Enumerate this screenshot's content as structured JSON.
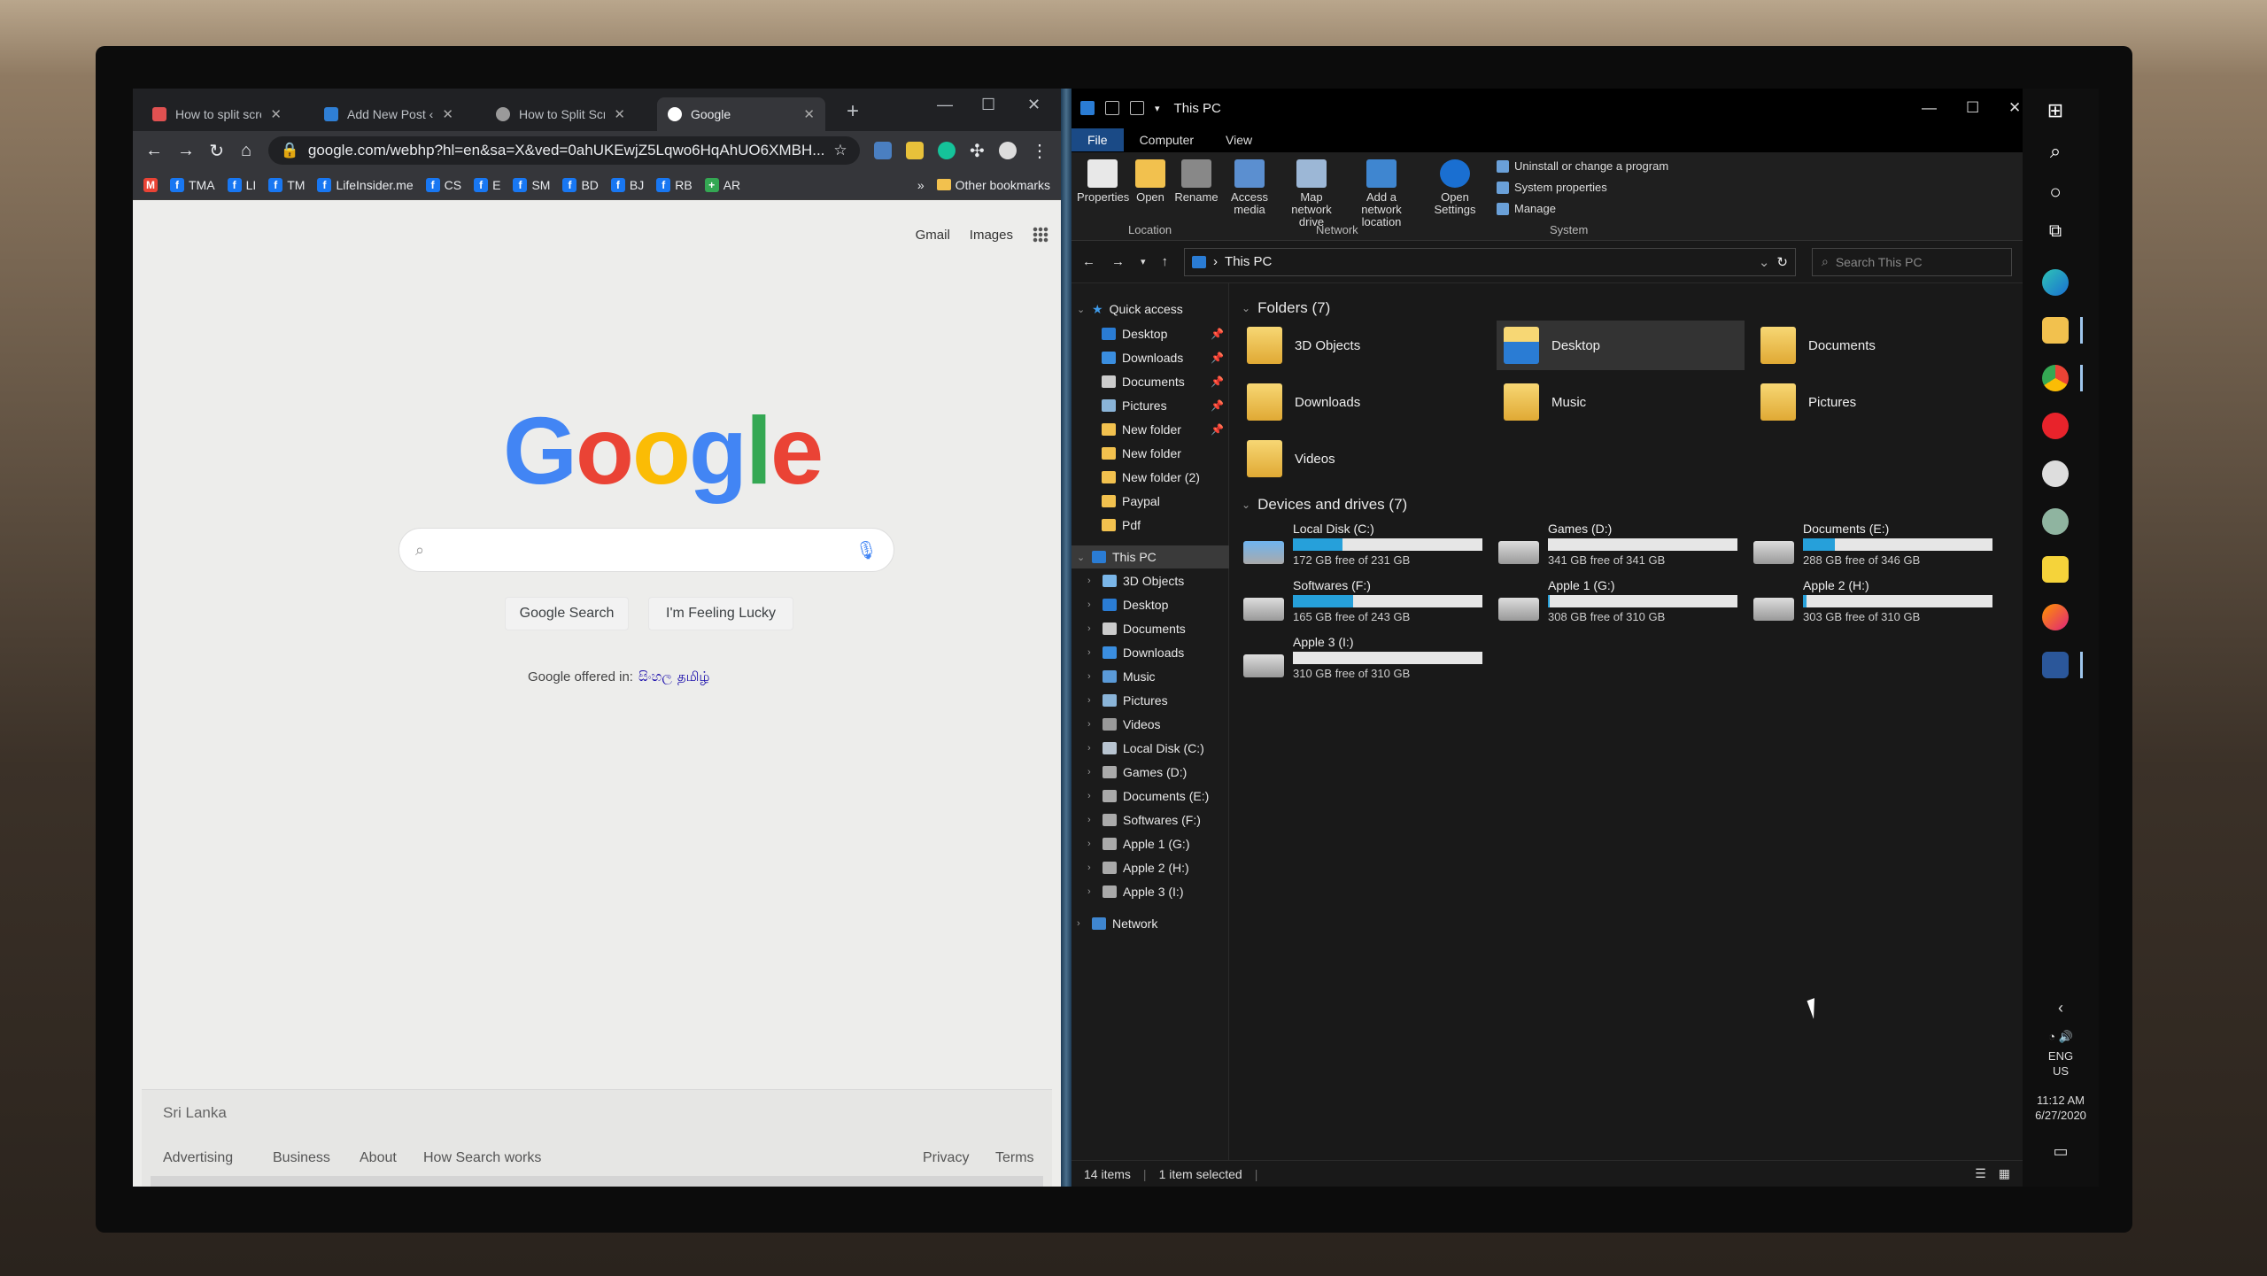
{
  "chrome": {
    "tabs": [
      {
        "label": "How to split screen",
        "color": "#e05151"
      },
      {
        "label": "Add New Post ‹ iHu",
        "color": "#2f7fd5"
      },
      {
        "label": "How to Split Screen",
        "color": "#9a9a9a"
      },
      {
        "label": "Google",
        "color": "#ffffff"
      }
    ],
    "url": "google.com/webhp?hl=en&sa=X&ved=0ahUKEwjZ5Lqwo6HqAhUO6XMBH...",
    "bookmarks": [
      {
        "label": "TMA"
      },
      {
        "label": "LI"
      },
      {
        "label": "TM"
      },
      {
        "label": "LifeInsider.me"
      },
      {
        "label": "CS"
      },
      {
        "label": "E"
      },
      {
        "label": "SM"
      },
      {
        "label": "BD"
      },
      {
        "label": "BJ"
      },
      {
        "label": "RB"
      },
      {
        "label": "AR"
      }
    ],
    "more_bookmarks": "»",
    "other_bookmarks": "Other bookmarks",
    "top_links": {
      "gmail": "Gmail",
      "images": "Images"
    },
    "logo": [
      "G",
      "o",
      "o",
      "g",
      "l",
      "e"
    ],
    "logo_colors": [
      "#4285f4",
      "#ea4335",
      "#fbbc05",
      "#4285f4",
      "#34a853",
      "#ea4335"
    ],
    "search_button": "Google Search",
    "lucky_button": "I'm Feeling Lucky",
    "offered_in": "Google offered in:",
    "languages": [
      "සිංහල",
      "தமிழ்"
    ],
    "country": "Sri Lanka",
    "footer_links": {
      "advertising": "Advertising",
      "business": "Business",
      "about": "About",
      "how": "How Search works",
      "privacy": "Privacy",
      "terms": "Terms"
    }
  },
  "explorer": {
    "title": "This PC",
    "ribbon_tabs": [
      "File",
      "Computer",
      "View"
    ],
    "ribbon_buttons": {
      "properties": "Properties",
      "open": "Open",
      "rename": "Rename",
      "access_media": "Access media",
      "map_drive": "Map network drive",
      "add_location": "Add a network location",
      "open_settings": "Open Settings"
    },
    "ribbon_small": {
      "uninstall": "Uninstall or change a program",
      "sysprops": "System properties",
      "manage": "Manage"
    },
    "groups": {
      "location": "Location",
      "network": "Network",
      "system": "System"
    },
    "address": "This PC",
    "search_placeholder": "Search This PC",
    "nav": {
      "quick_access": "Quick access",
      "quick_items": [
        "Desktop",
        "Downloads",
        "Documents",
        "Pictures",
        "New folder",
        "New folder",
        "New folder (2)",
        "Paypal",
        "Pdf"
      ],
      "this_pc": "This PC",
      "pc_items": [
        "3D Objects",
        "Desktop",
        "Documents",
        "Downloads",
        "Music",
        "Pictures",
        "Videos",
        "Local Disk (C:)",
        "Games (D:)",
        "Documents (E:)",
        "Softwares (F:)",
        "Apple 1 (G:)",
        "Apple 2 (H:)",
        "Apple 3 (I:)"
      ],
      "network": "Network"
    },
    "folders_header": "Folders (7)",
    "folders": [
      "3D Objects",
      "Desktop",
      "Documents",
      "Downloads",
      "Music",
      "Pictures",
      "Videos"
    ],
    "drives_header": "Devices and drives (7)",
    "drives": [
      {
        "name": "Local Disk (C:)",
        "free": "172 GB free of 231 GB",
        "used_fraction": 0.26
      },
      {
        "name": "Games (D:)",
        "free": "341 GB free of 341 GB",
        "used_fraction": 0.0
      },
      {
        "name": "Documents (E:)",
        "free": "288 GB free of 346 GB",
        "used_fraction": 0.17
      },
      {
        "name": "Softwares (F:)",
        "free": "165 GB free of 243 GB",
        "used_fraction": 0.32
      },
      {
        "name": "Apple 1 (G:)",
        "free": "308 GB free of 310 GB",
        "used_fraction": 0.01
      },
      {
        "name": "Apple 2 (H:)",
        "free": "303 GB free of 310 GB",
        "used_fraction": 0.02
      },
      {
        "name": "Apple 3 (I:)",
        "free": "310 GB free of 310 GB",
        "used_fraction": 0.0
      }
    ],
    "status": {
      "items": "14 items",
      "selected": "1 item selected"
    }
  },
  "taskbar": {
    "lang": "ENG",
    "region": "US",
    "time": "11:12 AM",
    "date": "6/27/2020"
  }
}
